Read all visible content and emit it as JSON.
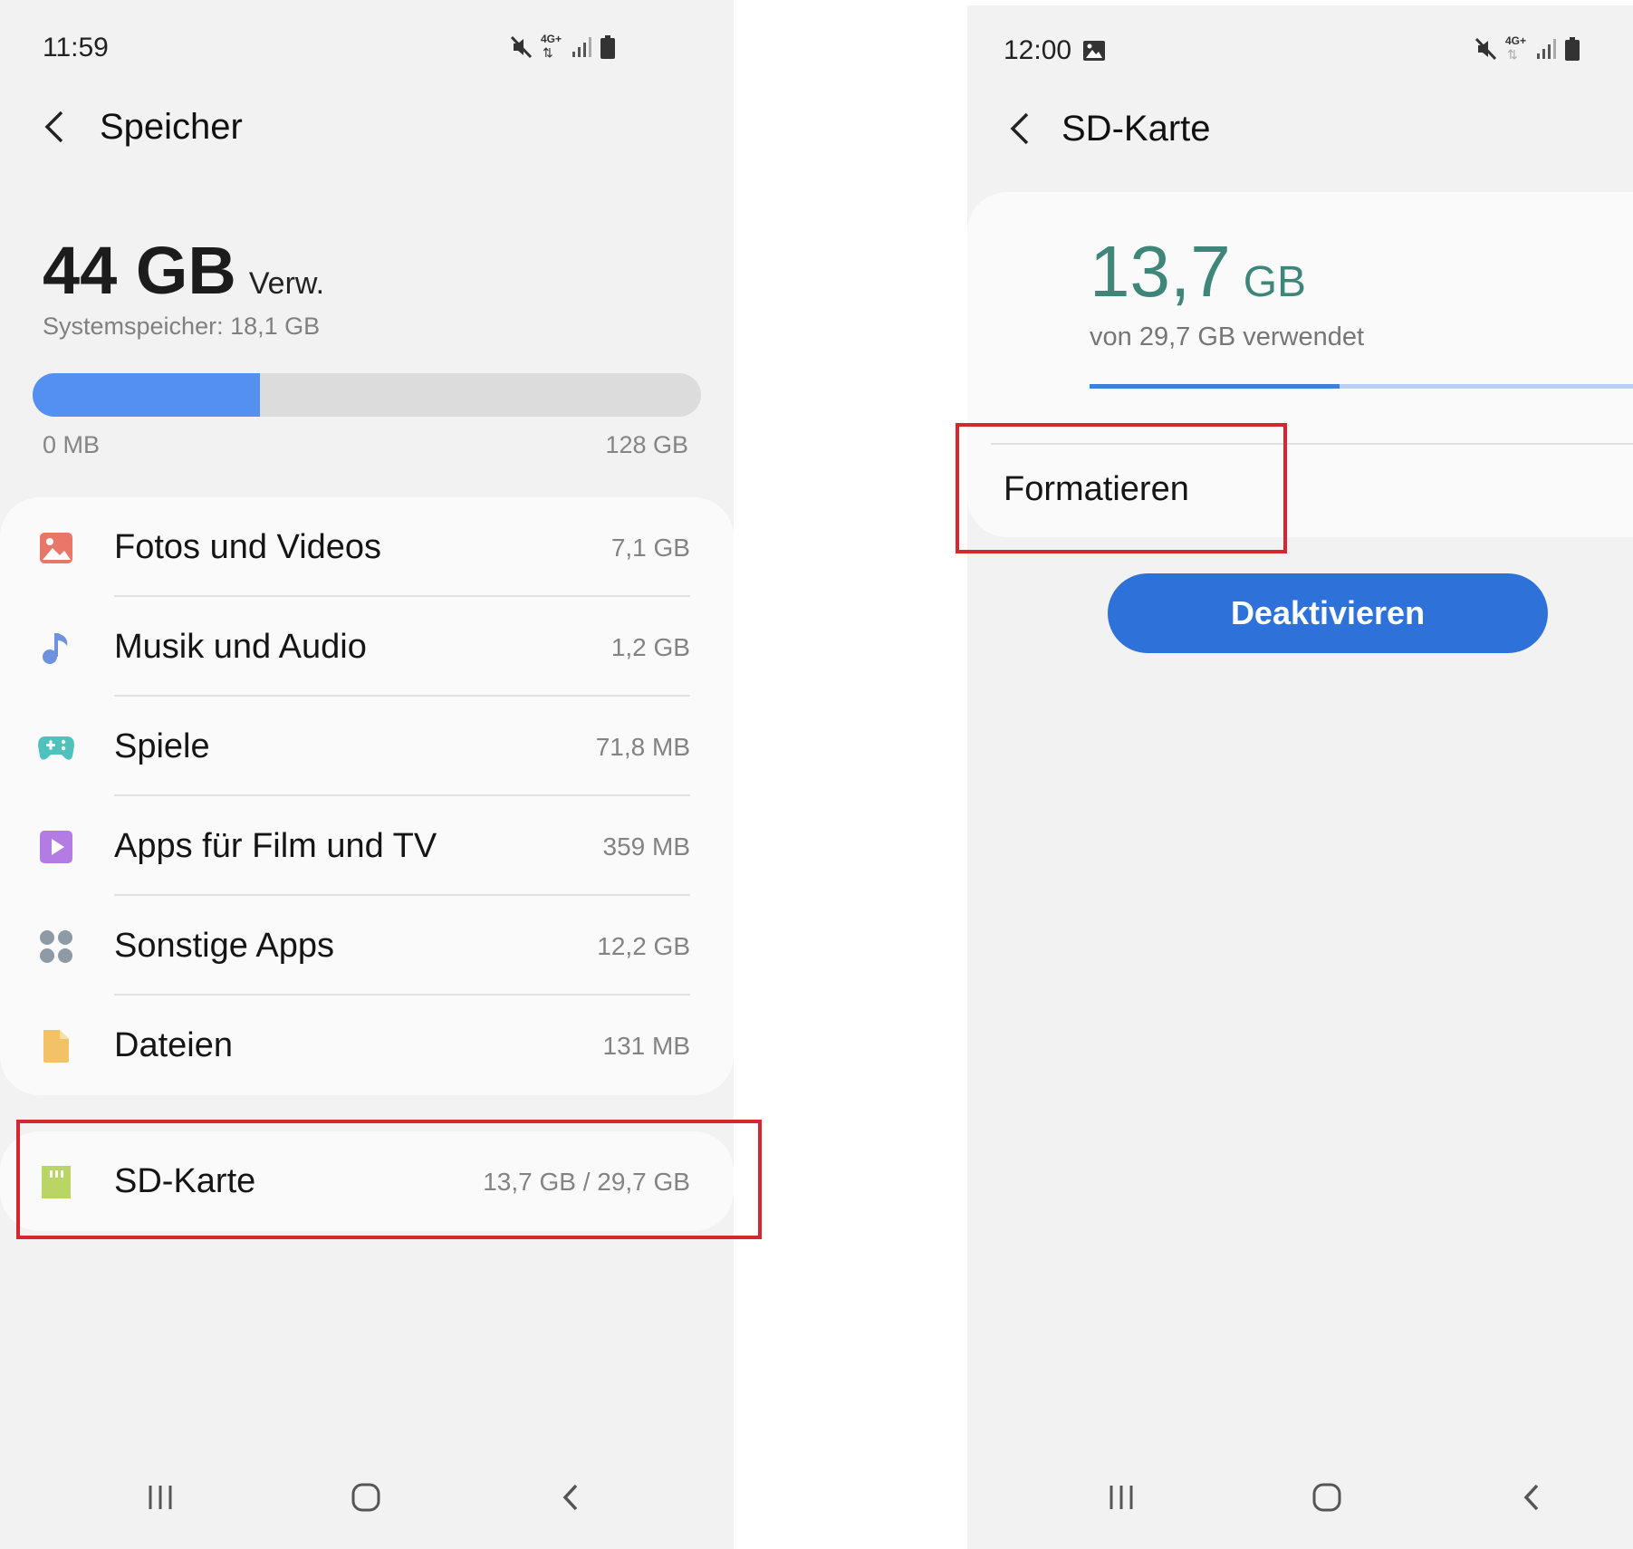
{
  "left_screen": {
    "status": {
      "time": "11:59",
      "network_label": "4G+"
    },
    "header": {
      "title": "Speicher"
    },
    "summary": {
      "used": "44 GB",
      "used_suffix": "Verw.",
      "system_memory": "Systemspeicher: 18,1 GB",
      "bar_fill_fraction": 0.34,
      "bar_min_label": "0 MB",
      "bar_max_label": "128 GB"
    },
    "categories": [
      {
        "label": "Fotos und Videos",
        "value": "7,1 GB",
        "icon": "photo-icon",
        "color": "#e8776a"
      },
      {
        "label": "Musik und Audio",
        "value": "1,2 GB",
        "icon": "music-note-icon",
        "color": "#6f92e0"
      },
      {
        "label": "Spiele",
        "value": "71,8 MB",
        "icon": "gamepad-icon",
        "color": "#4fc2bd"
      },
      {
        "label": "Apps für Film und TV",
        "value": "359 MB",
        "icon": "play-icon",
        "color": "#b37ce5"
      },
      {
        "label": "Sonstige Apps",
        "value": "12,2 GB",
        "icon": "apps-grid-icon",
        "color": "#8e9aa6"
      },
      {
        "label": "Dateien",
        "value": "131 MB",
        "icon": "file-icon",
        "color": "#f1c366"
      }
    ],
    "sd_card": {
      "label": "SD-Karte",
      "value": "13,7 GB / 29,7 GB",
      "icon": "sd-card-icon",
      "color": "#b9d565"
    }
  },
  "right_screen": {
    "status": {
      "time": "12:00",
      "network_label": "4G+"
    },
    "header": {
      "title": "SD-Karte"
    },
    "usage": {
      "used_value": "13,7",
      "used_unit": "GB",
      "sub_label": "von 29,7 GB verwendet",
      "bar_fill_fraction": 0.46
    },
    "format_label": "Formatieren",
    "deactivate_button": "Deaktivieren"
  },
  "colors": {
    "accent_blue": "#2e72d9",
    "teal": "#3e8679",
    "highlight_red": "#d7262f"
  }
}
